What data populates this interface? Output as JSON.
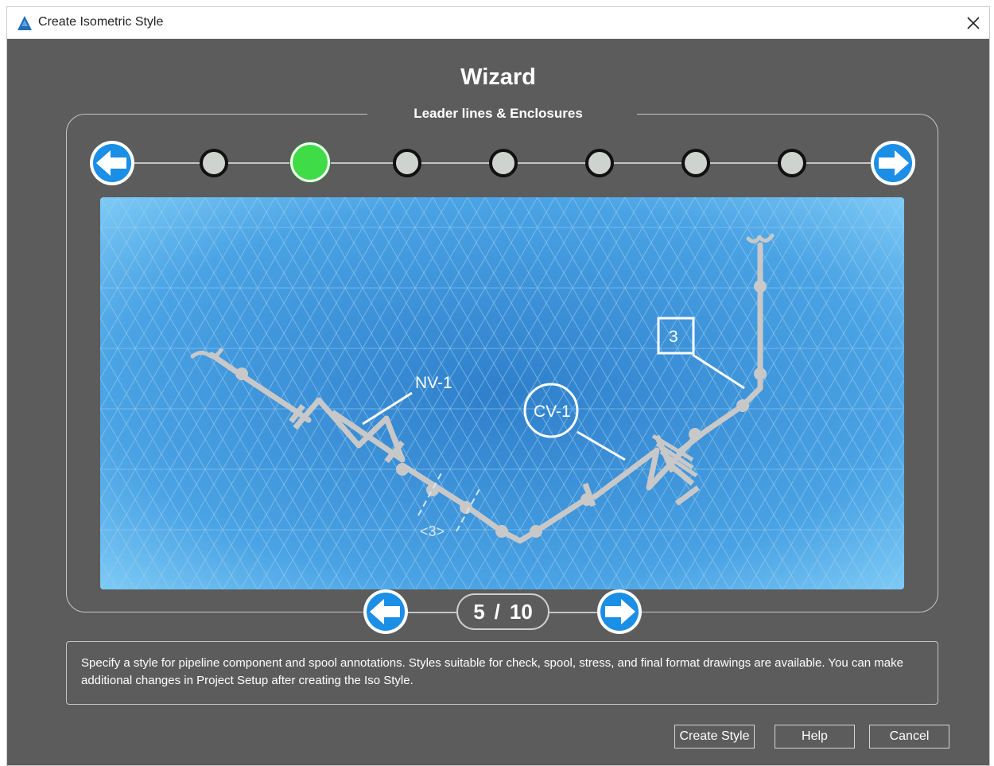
{
  "window": {
    "title": "Create Isometric Style",
    "accent_color": "#1f6fbf"
  },
  "wizard": {
    "title": "Wizard",
    "subtitle": "Leader lines & Enclosures",
    "steps_total": 8,
    "active_step": 3,
    "active_color": "#3fdc47"
  },
  "preview": {
    "labels": {
      "nv": "NV-1",
      "cv": "CV-1",
      "enclosure": "3",
      "dimension": "<3>"
    }
  },
  "pager": {
    "current": "5",
    "separator": "/",
    "total": "10"
  },
  "description": "Specify a style for pipeline component and spool annotations. Styles suitable for check, spool, stress, and final format drawings are available. You can make additional changes in Project Setup after creating the Iso Style.",
  "buttons": {
    "create": "Create Style",
    "help": "Help",
    "cancel": "Cancel"
  },
  "icons": {
    "app": "autocad-plant-icon",
    "close": "close-icon",
    "prev": "arrow-left-icon",
    "next": "arrow-right-icon"
  }
}
